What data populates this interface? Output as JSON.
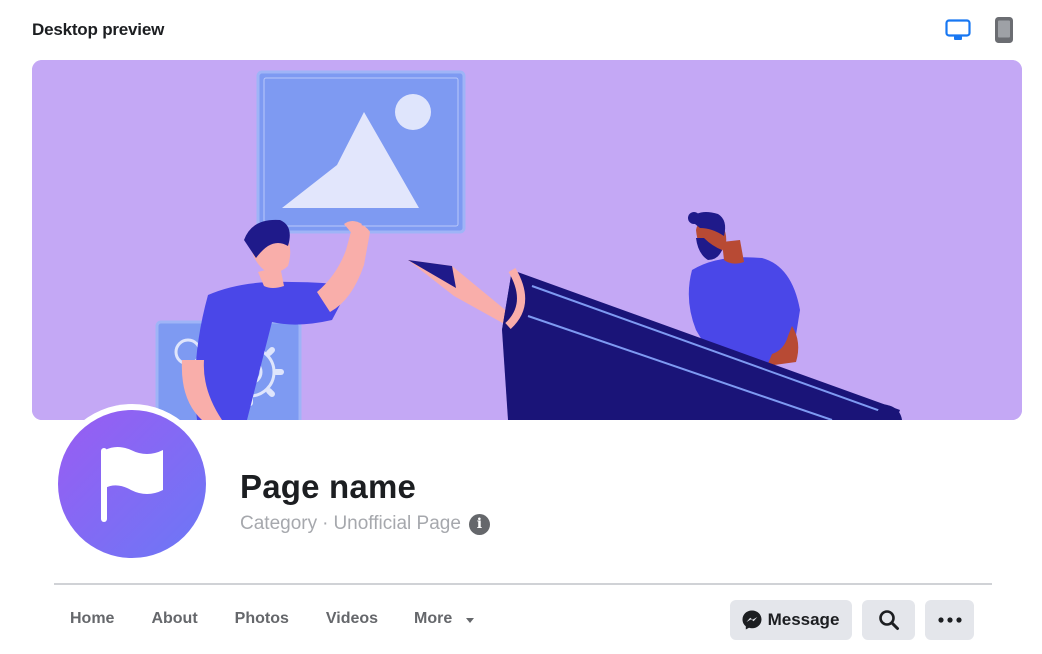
{
  "header": {
    "title": "Desktop preview",
    "devices": [
      {
        "name": "desktop",
        "icon": "monitor-icon",
        "active": true
      },
      {
        "name": "mobile",
        "icon": "phone-icon",
        "active": false
      }
    ],
    "active_color": "#1877f2",
    "inactive_color": "#65676b"
  },
  "cover": {
    "illustration": "cover-illustration",
    "background_color": "#c4a8f5"
  },
  "profile": {
    "avatar_icon": "flag-icon",
    "page_name": "Page name",
    "category": "Category",
    "separator": "·",
    "page_type": "Unofficial Page",
    "info_icon": "i"
  },
  "nav": {
    "tabs": [
      {
        "label": "Home"
      },
      {
        "label": "About"
      },
      {
        "label": "Photos"
      },
      {
        "label": "Videos"
      },
      {
        "label": "More"
      }
    ]
  },
  "actions": {
    "message_label": "Message",
    "message_icon": "messenger-icon",
    "search_icon": "search-icon",
    "more_icon": "more-dots-icon"
  }
}
